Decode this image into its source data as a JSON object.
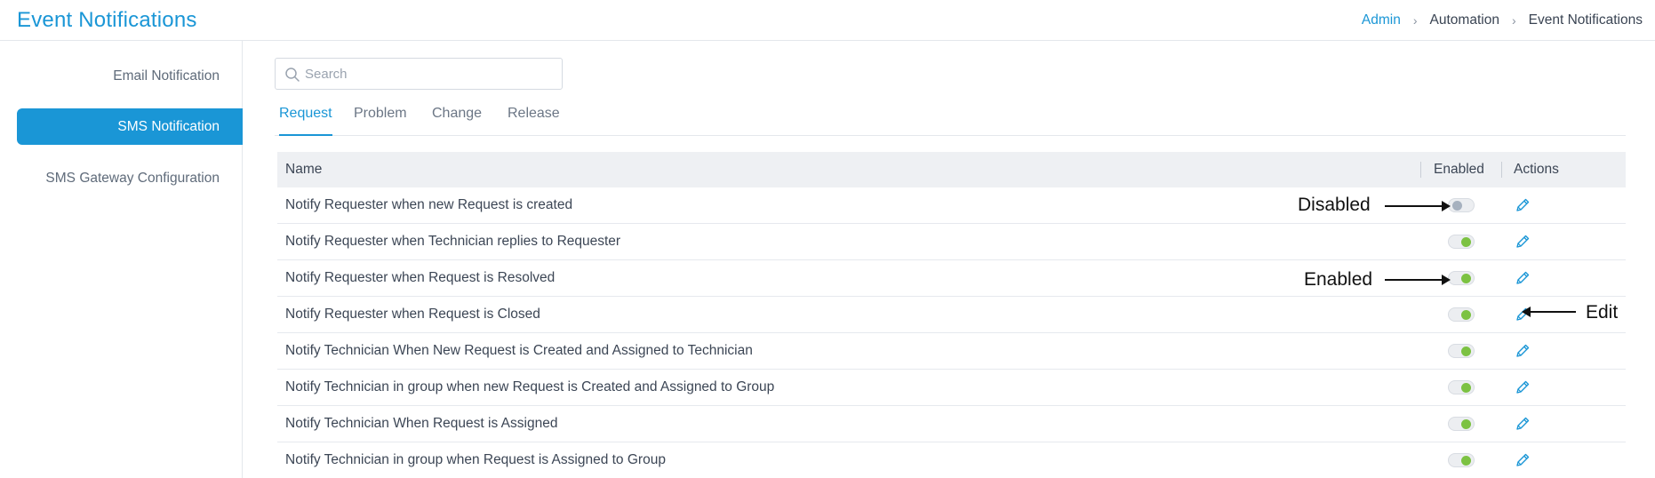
{
  "header": {
    "title": "Event Notifications",
    "breadcrumb": [
      "Admin",
      "Automation",
      "Event Notifications"
    ]
  },
  "sidebar": {
    "items": [
      {
        "label": "Email Notification",
        "active": false
      },
      {
        "label": "SMS Notification",
        "active": true
      },
      {
        "label": "SMS Gateway Configuration",
        "active": false
      }
    ]
  },
  "search": {
    "placeholder": "Search",
    "value": ""
  },
  "tabs": [
    {
      "label": "Request",
      "active": true
    },
    {
      "label": "Problem",
      "active": false
    },
    {
      "label": "Change",
      "active": false
    },
    {
      "label": "Release",
      "active": false
    }
  ],
  "table": {
    "columns": {
      "name": "Name",
      "enabled": "Enabled",
      "actions": "Actions"
    },
    "rows": [
      {
        "name": "Notify Requester when new Request is created",
        "enabled": false
      },
      {
        "name": "Notify Requester when Technician replies to Requester",
        "enabled": true
      },
      {
        "name": "Notify Requester when Request is Resolved",
        "enabled": true
      },
      {
        "name": "Notify Requester when Request is Closed",
        "enabled": true
      },
      {
        "name": "Notify Technician When New Request is Created and Assigned to Technician",
        "enabled": true
      },
      {
        "name": "Notify Technician in group when new Request is Created and Assigned to Group",
        "enabled": true
      },
      {
        "name": "Notify Technician When Request is Assigned",
        "enabled": true
      },
      {
        "name": "Notify Technician in group when Request is Assigned to Group",
        "enabled": true
      }
    ]
  },
  "annotations": {
    "disabled": "Disabled",
    "enabled": "Enabled",
    "edit": "Edit"
  },
  "icons": {
    "search": "search-icon",
    "edit": "pencil-icon",
    "breadcrumb_separator": "chevron-right-icon"
  },
  "colors": {
    "accent": "#1a96d6",
    "toggle_on": "#7cc242",
    "toggle_off": "#a6b1bf"
  }
}
